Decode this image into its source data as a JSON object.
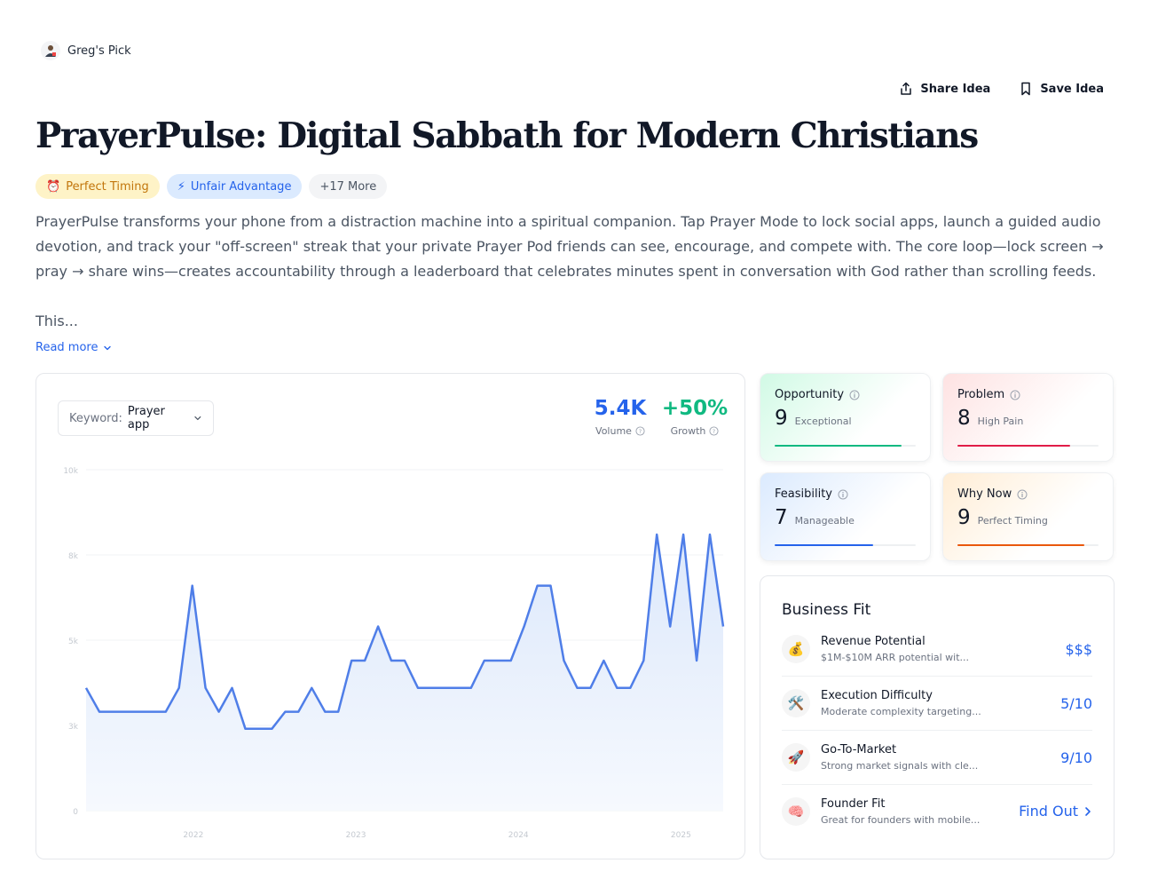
{
  "header": {
    "pick_label": "Greg's Pick",
    "share_label": "Share Idea",
    "save_label": "Save Idea"
  },
  "idea": {
    "title": "PrayerPulse: Digital Sabbath for Modern Christians",
    "tags": [
      {
        "icon": "⏰",
        "label": "Perfect Timing"
      },
      {
        "icon": "⚡",
        "label": "Unfair Advantage"
      },
      {
        "label": "+17 More"
      }
    ],
    "description": "PrayerPulse transforms your phone from a distraction machine into a spiritual companion. Tap Prayer Mode to lock social apps, launch a guided audio devotion, and track your \"off-screen\" streak that your private Prayer Pod friends can see, encourage, and compete with. The core loop—lock screen → pray → share wins—creates accountability through a leaderboard that celebrates minutes spent in conversation with God rather than scrolling feeds.",
    "description_more": "This...",
    "read_more": "Read more"
  },
  "trend": {
    "keyword_label": "Keyword:",
    "keyword_value": "Prayer app",
    "volume_value": "5.4K",
    "volume_label": "Volume",
    "growth_value": "+50%",
    "growth_label": "Growth"
  },
  "chart_data": {
    "type": "area",
    "title": "",
    "xlabel": "",
    "ylabel": "",
    "ylim": [
      0,
      10000
    ],
    "y_ticks": [
      "0",
      "3k",
      "5k",
      "8k",
      "10k"
    ],
    "x_ticks": [
      {
        "label": "2022",
        "x": 2022
      },
      {
        "label": "2023",
        "x": 2023
      },
      {
        "label": "2024",
        "x": 2024
      },
      {
        "label": "2025",
        "x": 2025
      }
    ],
    "x": [
      2021.34,
      2021.42,
      2021.51,
      2021.59,
      2021.67,
      2021.76,
      2021.84,
      2021.92,
      2022.01,
      2022.09,
      2022.17,
      2022.26,
      2022.34,
      2022.42,
      2022.51,
      2022.59,
      2022.67,
      2022.76,
      2022.84,
      2022.92,
      2023.01,
      2023.09,
      2023.17,
      2023.26,
      2023.34,
      2023.42,
      2023.51,
      2023.59,
      2023.67,
      2023.76,
      2023.84,
      2023.92,
      2024.01,
      2024.09,
      2024.17,
      2024.26,
      2024.34,
      2024.42,
      2024.51,
      2024.59,
      2024.67,
      2024.76,
      2024.84,
      2024.92,
      2025.01,
      2025.09,
      2025.17,
      2025.26
    ],
    "series": [
      {
        "color": "#4f7ee8",
        "values": [
          3600,
          2900,
          2900,
          2900,
          2900,
          2900,
          2900,
          3600,
          6600,
          3600,
          2900,
          3600,
          2400,
          2400,
          2400,
          2900,
          2900,
          3600,
          2900,
          2900,
          4400,
          4400,
          5400,
          4400,
          4400,
          3600,
          3600,
          3600,
          3600,
          3600,
          4400,
          4400,
          4400,
          5400,
          6600,
          6600,
          4400,
          3600,
          3600,
          4400,
          3600,
          3600,
          4400,
          8100,
          5400,
          8100,
          4400,
          8100,
          5400
        ]
      }
    ],
    "grid": true,
    "fill_gradient": [
      "#dce8fb",
      "#f6f9fe"
    ]
  },
  "scores": [
    {
      "key": "opp",
      "label": "Opportunity",
      "value": "9",
      "desc": "Exceptional",
      "fraction": 0.9,
      "color": "#10b981"
    },
    {
      "key": "prob",
      "label": "Problem",
      "value": "8",
      "desc": "High Pain",
      "fraction": 0.8,
      "color": "#e11d48"
    },
    {
      "key": "feas",
      "label": "Feasibility",
      "value": "7",
      "desc": "Manageable",
      "fraction": 0.7,
      "color": "#2563eb"
    },
    {
      "key": "why",
      "label": "Why Now",
      "value": "9",
      "desc": "Perfect Timing",
      "fraction": 0.9,
      "color": "#ea580c"
    }
  ],
  "business_fit": {
    "title": "Business Fit",
    "rows": [
      {
        "icon": "💰",
        "name": "Revenue Potential",
        "desc": "$1M-$10M ARR potential wit...",
        "value": "$$$"
      },
      {
        "icon": "🛠️",
        "name": "Execution Difficulty",
        "desc": "Moderate complexity targeting...",
        "value": "5/10"
      },
      {
        "icon": "🚀",
        "name": "Go-To-Market",
        "desc": "Strong market signals with cle...",
        "value": "9/10"
      },
      {
        "icon": "🧠",
        "name": "Founder Fit",
        "desc": "Great for founders with mobile...",
        "value": "Find Out"
      }
    ]
  }
}
